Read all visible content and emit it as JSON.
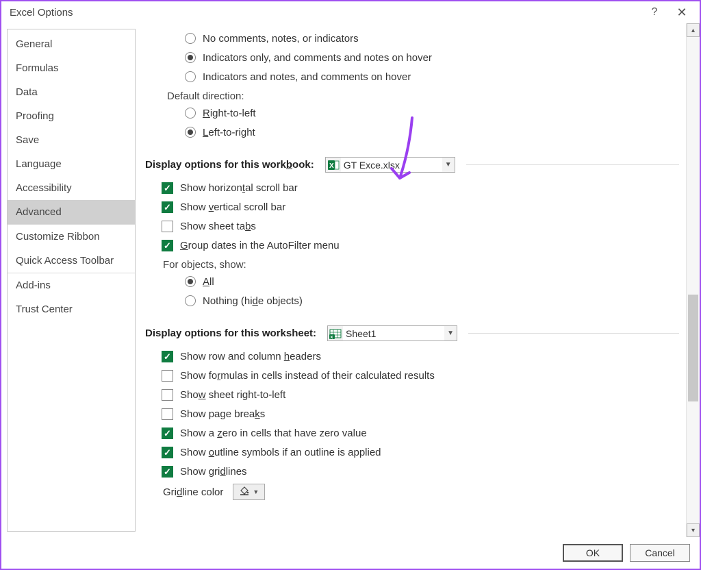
{
  "titlebar": {
    "title": "Excel Options"
  },
  "sidebar": {
    "items": [
      "General",
      "Formulas",
      "Data",
      "Proofing",
      "Save",
      "Language",
      "Accessibility",
      "Advanced",
      "Customize Ribbon",
      "Quick Access Toolbar",
      "Add-ins",
      "Trust Center"
    ],
    "selected_index": 7
  },
  "comments_notes": {
    "r1": "No comments, notes, or indicators",
    "r2": "Indicators only, and comments and notes on hover",
    "r3": "Indicators and notes, and comments on hover",
    "selected": "r2"
  },
  "default_direction": {
    "label": "Default direction:",
    "r1": "Right-to-left",
    "r2": "Left-to-right",
    "selected": "r2"
  },
  "section_workbook": {
    "label": "Display options for this workbook:",
    "dropdown_value": "GT Exce.xlsx",
    "cb_h_scroll": "Show horizontal scroll bar",
    "cb_v_scroll": "Show vertical scroll bar",
    "cb_tabs": "Show sheet tabs",
    "cb_group_dates": "Group dates in the AutoFilter menu",
    "objects_label": "For objects, show:",
    "obj_all": "All",
    "obj_nothing": "Nothing (hide objects)",
    "obj_selected": "all"
  },
  "section_worksheet": {
    "label": "Display options for this worksheet:",
    "dropdown_value": "Sheet1",
    "cb_headers": "Show row and column headers",
    "cb_formulas": "Show formulas in cells instead of their calculated results",
    "cb_rtl": "Show sheet right-to-left",
    "cb_pagebreaks": "Show page breaks",
    "cb_zero": "Show a zero in cells that have zero value",
    "cb_outline": "Show outline symbols if an outline is applied",
    "cb_gridlines": "Show gridlines",
    "gridline_color_label": "Gridline color"
  },
  "footer": {
    "ok": "OK",
    "cancel": "Cancel"
  }
}
